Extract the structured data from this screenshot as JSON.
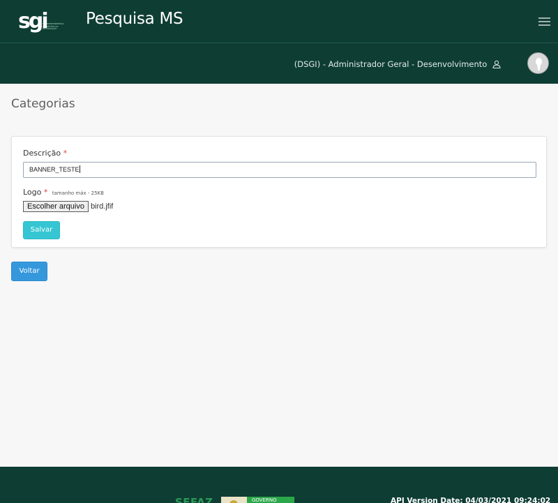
{
  "header": {
    "logo_text": "sgi",
    "logo_subtext": "SUPERINTENDÊNCIA DE GESTÃO DA INFORMAÇÃO",
    "app_title": "Pesquisa MS",
    "menu_icon": "hamburger-icon"
  },
  "userbar": {
    "user_label": "(DSGI) - Administrador Geral - Desenvolvimento",
    "user_icon": "user-icon",
    "avatar_icon": "avatar-icon"
  },
  "page": {
    "title": "Categorias"
  },
  "form": {
    "descricao_label": "Descrição",
    "required_mark": "*",
    "descricao_value": "BANNER_TESTE",
    "logo_label": "Logo",
    "logo_hint": "tamanho máx - 25KB",
    "file_button_label": "Escolher arquivo",
    "file_name": "bird.jfif",
    "save_label": "Salvar"
  },
  "actions": {
    "back_label": "Voltar"
  },
  "footer": {
    "sefaz_text": "SEFAZ",
    "gov_text": "GOVERNO",
    "api_version": "API Version Date: 04/03/2021 09:24:02"
  },
  "colors": {
    "header_bg": "#0e3d34",
    "save_button": "#36c6d3",
    "back_button": "#3598dc",
    "required": "#e04040"
  }
}
